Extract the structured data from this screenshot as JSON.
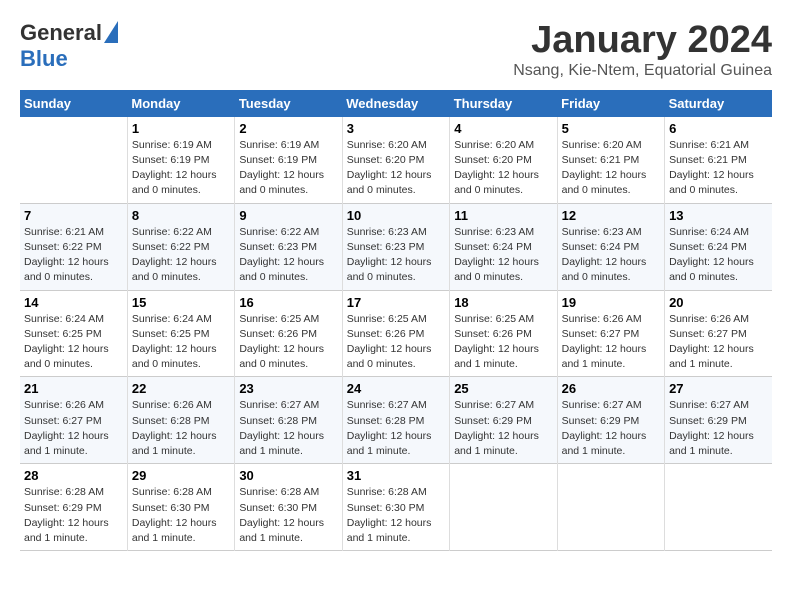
{
  "logo": {
    "general": "General",
    "blue": "Blue"
  },
  "title": "January 2024",
  "subtitle": "Nsang, Kie-Ntem, Equatorial Guinea",
  "days_header": [
    "Sunday",
    "Monday",
    "Tuesday",
    "Wednesday",
    "Thursday",
    "Friday",
    "Saturday"
  ],
  "weeks": [
    [
      {
        "day": "",
        "info": ""
      },
      {
        "day": "1",
        "info": "Sunrise: 6:19 AM\nSunset: 6:19 PM\nDaylight: 12 hours and 0 minutes."
      },
      {
        "day": "2",
        "info": "Sunrise: 6:19 AM\nSunset: 6:19 PM\nDaylight: 12 hours and 0 minutes."
      },
      {
        "day": "3",
        "info": "Sunrise: 6:20 AM\nSunset: 6:20 PM\nDaylight: 12 hours and 0 minutes."
      },
      {
        "day": "4",
        "info": "Sunrise: 6:20 AM\nSunset: 6:20 PM\nDaylight: 12 hours and 0 minutes."
      },
      {
        "day": "5",
        "info": "Sunrise: 6:20 AM\nSunset: 6:21 PM\nDaylight: 12 hours and 0 minutes."
      },
      {
        "day": "6",
        "info": "Sunrise: 6:21 AM\nSunset: 6:21 PM\nDaylight: 12 hours and 0 minutes."
      }
    ],
    [
      {
        "day": "7",
        "info": "Sunrise: 6:21 AM\nSunset: 6:22 PM\nDaylight: 12 hours and 0 minutes."
      },
      {
        "day": "8",
        "info": "Sunrise: 6:22 AM\nSunset: 6:22 PM\nDaylight: 12 hours and 0 minutes."
      },
      {
        "day": "9",
        "info": "Sunrise: 6:22 AM\nSunset: 6:23 PM\nDaylight: 12 hours and 0 minutes."
      },
      {
        "day": "10",
        "info": "Sunrise: 6:23 AM\nSunset: 6:23 PM\nDaylight: 12 hours and 0 minutes."
      },
      {
        "day": "11",
        "info": "Sunrise: 6:23 AM\nSunset: 6:24 PM\nDaylight: 12 hours and 0 minutes."
      },
      {
        "day": "12",
        "info": "Sunrise: 6:23 AM\nSunset: 6:24 PM\nDaylight: 12 hours and 0 minutes."
      },
      {
        "day": "13",
        "info": "Sunrise: 6:24 AM\nSunset: 6:24 PM\nDaylight: 12 hours and 0 minutes."
      }
    ],
    [
      {
        "day": "14",
        "info": "Sunrise: 6:24 AM\nSunset: 6:25 PM\nDaylight: 12 hours and 0 minutes."
      },
      {
        "day": "15",
        "info": "Sunrise: 6:24 AM\nSunset: 6:25 PM\nDaylight: 12 hours and 0 minutes."
      },
      {
        "day": "16",
        "info": "Sunrise: 6:25 AM\nSunset: 6:26 PM\nDaylight: 12 hours and 0 minutes."
      },
      {
        "day": "17",
        "info": "Sunrise: 6:25 AM\nSunset: 6:26 PM\nDaylight: 12 hours and 0 minutes."
      },
      {
        "day": "18",
        "info": "Sunrise: 6:25 AM\nSunset: 6:26 PM\nDaylight: 12 hours and 1 minute."
      },
      {
        "day": "19",
        "info": "Sunrise: 6:26 AM\nSunset: 6:27 PM\nDaylight: 12 hours and 1 minute."
      },
      {
        "day": "20",
        "info": "Sunrise: 6:26 AM\nSunset: 6:27 PM\nDaylight: 12 hours and 1 minute."
      }
    ],
    [
      {
        "day": "21",
        "info": "Sunrise: 6:26 AM\nSunset: 6:27 PM\nDaylight: 12 hours and 1 minute."
      },
      {
        "day": "22",
        "info": "Sunrise: 6:26 AM\nSunset: 6:28 PM\nDaylight: 12 hours and 1 minute."
      },
      {
        "day": "23",
        "info": "Sunrise: 6:27 AM\nSunset: 6:28 PM\nDaylight: 12 hours and 1 minute."
      },
      {
        "day": "24",
        "info": "Sunrise: 6:27 AM\nSunset: 6:28 PM\nDaylight: 12 hours and 1 minute."
      },
      {
        "day": "25",
        "info": "Sunrise: 6:27 AM\nSunset: 6:29 PM\nDaylight: 12 hours and 1 minute."
      },
      {
        "day": "26",
        "info": "Sunrise: 6:27 AM\nSunset: 6:29 PM\nDaylight: 12 hours and 1 minute."
      },
      {
        "day": "27",
        "info": "Sunrise: 6:27 AM\nSunset: 6:29 PM\nDaylight: 12 hours and 1 minute."
      }
    ],
    [
      {
        "day": "28",
        "info": "Sunrise: 6:28 AM\nSunset: 6:29 PM\nDaylight: 12 hours and 1 minute."
      },
      {
        "day": "29",
        "info": "Sunrise: 6:28 AM\nSunset: 6:30 PM\nDaylight: 12 hours and 1 minute."
      },
      {
        "day": "30",
        "info": "Sunrise: 6:28 AM\nSunset: 6:30 PM\nDaylight: 12 hours and 1 minute."
      },
      {
        "day": "31",
        "info": "Sunrise: 6:28 AM\nSunset: 6:30 PM\nDaylight: 12 hours and 1 minute."
      },
      {
        "day": "",
        "info": ""
      },
      {
        "day": "",
        "info": ""
      },
      {
        "day": "",
        "info": ""
      }
    ]
  ]
}
